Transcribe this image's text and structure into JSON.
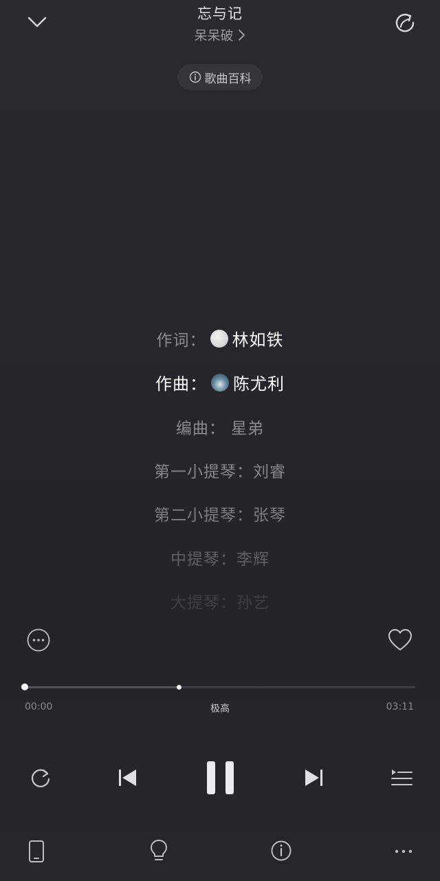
{
  "header": {
    "title": "忘与记",
    "artist": "呆呆破",
    "wiki_label": "歌曲百科"
  },
  "credits": [
    {
      "role": "作词：",
      "name": "林如铁",
      "has_avatar": true
    },
    {
      "role": "作曲：",
      "name": "陈尤利",
      "has_avatar": true
    },
    {
      "text": "编曲：  星弟"
    },
    {
      "text": "第一小提琴：刘睿"
    },
    {
      "text": "第二小提琴：张琴"
    },
    {
      "text": "中提琴：李辉"
    },
    {
      "text": "大提琴：孙艺"
    }
  ],
  "player": {
    "current_time": "00:00",
    "total_time": "03:11",
    "quality": "极高",
    "progress_fraction": 0.0,
    "buffered_fraction": 0.395
  },
  "icons": {
    "collapse": "chevron-down-icon",
    "share": "share-icon",
    "more": "more-circle-icon",
    "like": "heart-icon",
    "repeat": "repeat-icon",
    "prev": "skip-previous-icon",
    "pause": "pause-icon",
    "next": "skip-next-icon",
    "playlist": "playlist-icon",
    "device": "phone-device-icon",
    "bulb": "lightbulb-icon",
    "info": "info-icon",
    "overflow": "more-horizontal-icon"
  },
  "colors": {
    "background": "#27272c",
    "active_text": "#ffffff",
    "inactive_text": "#8d8d92"
  }
}
